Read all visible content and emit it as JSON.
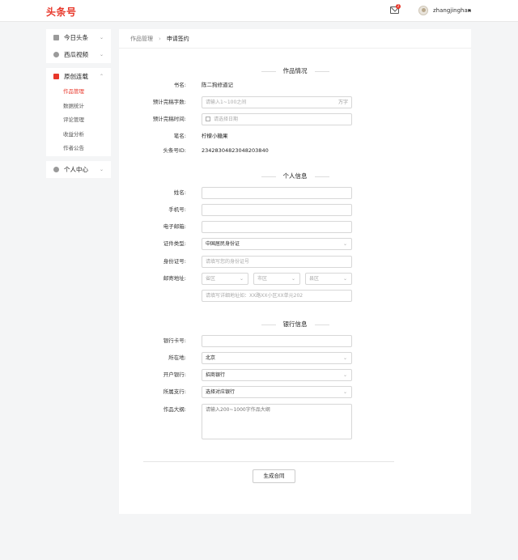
{
  "header": {
    "logo": "头条号",
    "mail_badge": "2",
    "username": "zhangjinghan"
  },
  "sidebar": {
    "groups": [
      {
        "label": "今日头条",
        "icon": "calendar-icon"
      },
      {
        "label": "西瓜视频",
        "icon": "video-icon"
      },
      {
        "label": "原创连载",
        "icon": "book-icon"
      },
      {
        "label": "个人中心",
        "icon": "person-icon"
      }
    ],
    "sub_items": [
      "作品管理",
      "数据统计",
      "评论管理",
      "收益分析",
      "作者公告"
    ]
  },
  "breadcrumb": {
    "parent": "作品管理",
    "sep": "›",
    "current": "申请签约"
  },
  "work": {
    "title": "作品情况",
    "book_label": "书名:",
    "book_value": "陈二狗修道记",
    "wordcount_label": "预计完稿字数:",
    "wordcount_placeholder": "请输入1~100之间",
    "wordcount_suffix": "万字",
    "finish_label": "预计完稿时间:",
    "finish_placeholder": "请选择日期",
    "pen_label": "笔名:",
    "pen_value": "柠檬小糖果",
    "id_label": "头条号ID:",
    "id_value": "23428304823048203840"
  },
  "personal": {
    "title": "个人信息",
    "name_label": "姓名:",
    "phone_label": "手机号:",
    "email_label": "电子邮箱:",
    "idtype_label": "证件类型:",
    "idtype_value": "中国居民身份证",
    "idno_label": "身份证号:",
    "idno_placeholder": "请填写您的身份证号",
    "addr_label": "邮寄地址:",
    "province_placeholder": "省区",
    "city_placeholder": "市区",
    "county_placeholder": "县区",
    "addr_detail_placeholder": "请填写详细地址如：XX路XX小区XX单元202"
  },
  "bank": {
    "title": "银行信息",
    "card_label": "银行卡号:",
    "location_label": "所在地:",
    "location_value": "北京",
    "bank_label": "开户银行:",
    "bank_value": "招商银行",
    "branch_label": "所属支行:",
    "branch_value": "选择对应银行",
    "outline_label": "作品大纲:",
    "outline_placeholder": "请输入200~1000字作品大纲"
  },
  "submit_label": "生成合同"
}
